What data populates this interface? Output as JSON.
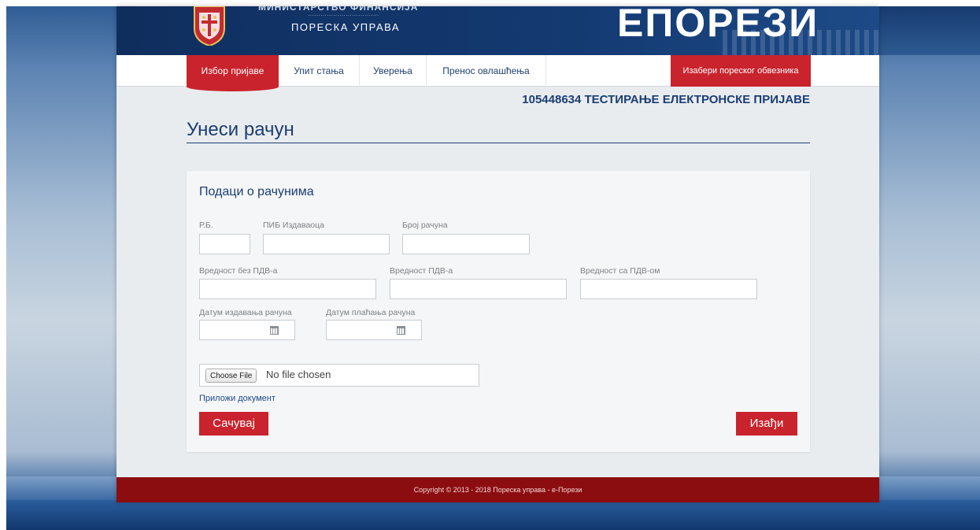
{
  "header": {
    "ministry": "МИНИСТАРСТВО ФИНАНСИЈА",
    "agency": "ПОРЕСКА УПРАВА",
    "brand": "ЕПОРЕЗИ"
  },
  "nav": {
    "items": [
      {
        "label": "Избор пријаве",
        "active": true
      },
      {
        "label": "Упит стања",
        "active": false
      },
      {
        "label": "Уверења",
        "active": false
      },
      {
        "label": "Пренос овлашћења",
        "active": false
      }
    ],
    "select_taxpayer": "Изабери пореског обвезника"
  },
  "taxpayer": "105448634 ТЕСТИРАЊЕ ЕЛЕКТРОНСКЕ ПРИЈАВЕ",
  "page_title": "Унеси рачун",
  "form": {
    "section_title": "Подаци о рачунима",
    "fields": {
      "rb": {
        "label": "Р.Б.",
        "value": ""
      },
      "pib": {
        "label": "ПИБ Издаваоца",
        "value": ""
      },
      "invoice_no": {
        "label": "Број рачуна",
        "value": ""
      },
      "value_no_vat": {
        "label": "Вредност без ПДВ-а",
        "value": ""
      },
      "vat_value": {
        "label": "Вредност ПДВ-а",
        "value": ""
      },
      "value_with_vat": {
        "label": "Вредност са ПДВ-ом",
        "value": ""
      },
      "issue_date": {
        "label": "Датум издавања рачуна",
        "value": ""
      },
      "payment_date": {
        "label": "Датум плаћања рачуна",
        "value": ""
      }
    },
    "file": {
      "button": "Choose File",
      "status": "No file chosen"
    },
    "attach_link": "Приложи документ",
    "save_button": "Сачувај",
    "exit_button": "Изађи"
  },
  "footer": "Copyright © 2013 - 2018 Пореска управа - е-Порези",
  "colors": {
    "accent": "#c9232d",
    "navy": "#1a3d73",
    "footer": "#8c0d10"
  }
}
